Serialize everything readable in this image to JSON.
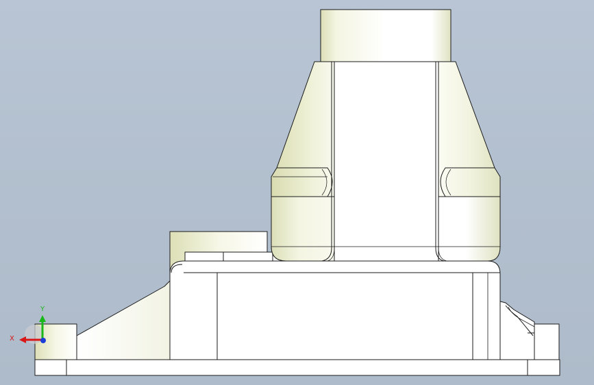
{
  "viewport": {
    "background_top": "#b9c5d4",
    "background_bottom": "#aebbca"
  },
  "model": {
    "face_color": "#ffffff",
    "shaded_color": "#e6e9c8",
    "edge_color": "#1a1a1a"
  },
  "triad": {
    "x_label": "X",
    "y_label": "Y",
    "x_color": "#d81818",
    "y_color": "#18b818",
    "z_color": "#1a3cd8"
  }
}
